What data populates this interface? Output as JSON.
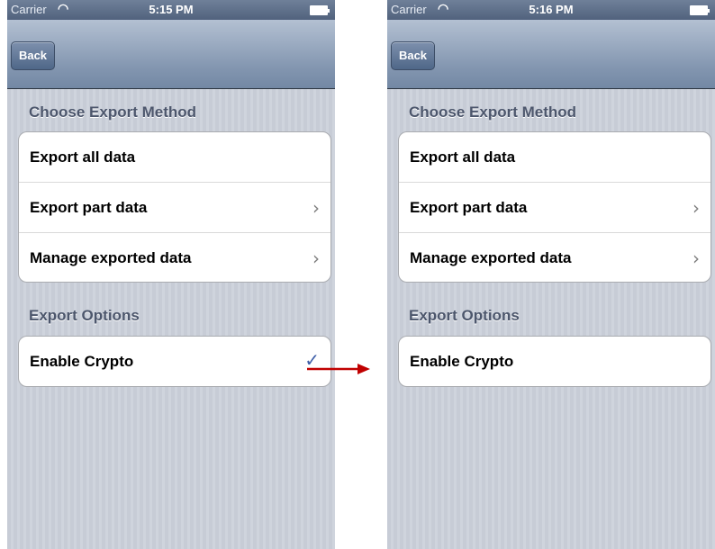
{
  "left_screen": {
    "status": {
      "carrier": "Carrier",
      "time": "5:15 PM",
      "wifi_icon": "wifi-icon",
      "battery_icon": "battery-icon"
    },
    "nav": {
      "back_label": "Back"
    },
    "section_method": "Choose Export Method",
    "cells": [
      {
        "label": "Export all data",
        "accessory": "none"
      },
      {
        "label": "Export part data",
        "accessory": "chevron",
        "accessory_glyph": "›"
      },
      {
        "label": "Manage exported data",
        "accessory": "chevron",
        "accessory_glyph": "›"
      }
    ],
    "section_options": "Export Options",
    "option": {
      "label": "Enable Crypto",
      "checked": true,
      "check_glyph": "✓"
    }
  },
  "right_screen": {
    "status": {
      "carrier": "Carrier",
      "time": "5:16 PM",
      "wifi_icon": "wifi-icon",
      "battery_icon": "battery-icon"
    },
    "nav": {
      "back_label": "Back"
    },
    "section_method": "Choose Export Method",
    "cells": [
      {
        "label": "Export all data",
        "accessory": "none"
      },
      {
        "label": "Export part data",
        "accessory": "chevron",
        "accessory_glyph": "›"
      },
      {
        "label": "Manage exported data",
        "accessory": "chevron",
        "accessory_glyph": "›"
      }
    ],
    "section_options": "Export Options",
    "option": {
      "label": "Enable Crypto",
      "checked": false
    }
  },
  "colors": {
    "nav_bar": "#8396b0",
    "background": "#cbd0d9",
    "section_text": "#4c566c",
    "checkmark": "#3f5fa8",
    "arrow": "#c00000"
  }
}
